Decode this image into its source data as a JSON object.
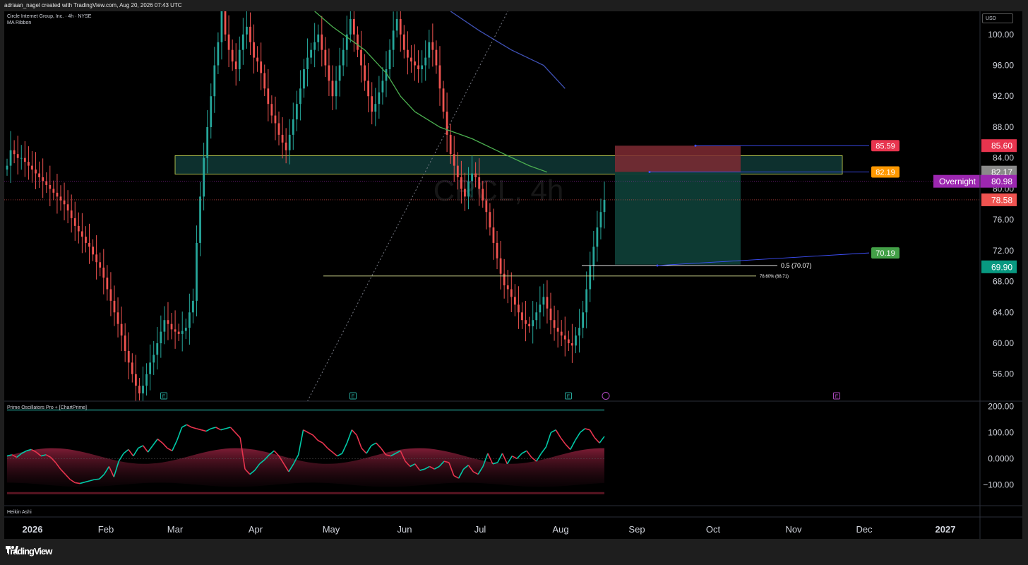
{
  "header": {
    "credit": "adriaan_nagel created with TradingView.com, Aug 20, 2026 07:43 UTC"
  },
  "legend": {
    "symbol_line": "Circle Internet Group, Inc. · 4h · NYSE",
    "indicator": "MA Ribbon",
    "watermark": "CRCL, 4h",
    "oscillator": "Prime Oscillators Pro + [ChartPrime]",
    "chart_style": "Heikin Ashi"
  },
  "currency": "USD",
  "footer": {
    "brand": "TradingView",
    "logo": "tradingview-logo-icon"
  },
  "colors": {
    "up": "#26a69a",
    "down": "#ef5350",
    "ma_fast": "#4caf50",
    "ma_slow": "#3f51b5",
    "zone": "#1d6b66",
    "stop": "#7f2a33",
    "target": "#0e3d36",
    "ob_green": "#00c9a7",
    "ob_red": "#e8344e",
    "bg": "#000000"
  },
  "chart_data": {
    "type": "candlestick",
    "title": "Circle Internet Group, Inc. · 4h · NYSE",
    "symbol": "CRCL",
    "interval": "4h",
    "x_axis_labels": [
      "2026",
      "Feb",
      "Mar",
      "Apr",
      "May",
      "Jun",
      "Jul",
      "Aug",
      "Sep",
      "Oct",
      "Nov",
      "Dec",
      "2027"
    ],
    "y_axis_ticks": [
      100,
      96,
      92,
      88,
      84,
      80,
      76,
      72,
      68,
      64,
      60,
      56
    ],
    "y_axis_tick_labels": [
      "100.00",
      "96.00",
      "92.00",
      "88.00",
      "84.00",
      "80.00",
      "76.00",
      "72.00",
      "68.00",
      "64.00",
      "60.00",
      "56.00"
    ],
    "ylim": [
      52.5,
      103
    ],
    "price_labels": [
      {
        "text": "85.60",
        "value": 85.6,
        "color": "#e8344e"
      },
      {
        "text": "82.17",
        "value": 82.17,
        "color": "#8a8a8a"
      },
      {
        "text": "80.98",
        "value": 80.98,
        "color": "#9c27b0",
        "tag": "Overnight"
      },
      {
        "text": "78.58",
        "value": 78.58,
        "color": "#ef5350"
      },
      {
        "text": "69.90",
        "value": 69.9,
        "color": "#089981"
      }
    ],
    "position_levels": [
      {
        "text": "85.59",
        "value": 85.59,
        "color": "#e8344e"
      },
      {
        "text": "82.19",
        "value": 82.19,
        "color": "#ff9800"
      },
      {
        "text": "70.19",
        "value": 70.19,
        "color": "#43a047"
      }
    ],
    "fib_levels": [
      {
        "text": "0.5 (70.07)",
        "value": 70.07
      },
      {
        "text": "78.60% (68.71)",
        "value": 68.71
      }
    ],
    "resistance_zone": [
      81.9,
      84.3
    ],
    "candle_closes": [
      83,
      85,
      84.5,
      84,
      84,
      83.5,
      83,
      82.5,
      82,
      81.5,
      81,
      80.5,
      80,
      79.5,
      79,
      78.5,
      78,
      77.2,
      76.2,
      75.2,
      74.5,
      73.8,
      73,
      72.5,
      71.5,
      70.5,
      69.8,
      68.5,
      67,
      65.5,
      64,
      62.5,
      61,
      59,
      57.5,
      56,
      54.5,
      53.5,
      54.5,
      56,
      57.5,
      58.5,
      60,
      61.5,
      63,
      62.5,
      61.8,
      61.5,
      61.2,
      61.6,
      62,
      64,
      65.5,
      73,
      79,
      84,
      88,
      92,
      96,
      99,
      103,
      100,
      98,
      96.5,
      95.5,
      98,
      100,
      101,
      99,
      97,
      96.5,
      95,
      93,
      91,
      89.5,
      88.5,
      87,
      86,
      85,
      87,
      89,
      91,
      93,
      95.5,
      97,
      98,
      99,
      100,
      98,
      96,
      94,
      92,
      94,
      96,
      98,
      100,
      102,
      100,
      98,
      96,
      94,
      92,
      90,
      91,
      92.5,
      94,
      95.5,
      98,
      100.5,
      102,
      100,
      98,
      97,
      96.5,
      96,
      95.5,
      96,
      97,
      99,
      98,
      96,
      93,
      90,
      87,
      84.5,
      83,
      81.5,
      80,
      79,
      81,
      82,
      81.5,
      80,
      78.5,
      77,
      75,
      73,
      71,
      69,
      67.5,
      67,
      66,
      65,
      64,
      63,
      62.5,
      62.2,
      63,
      64,
      65,
      66,
      64.5,
      63,
      62,
      61.5,
      61,
      60.5,
      60,
      59.7,
      61,
      62,
      64,
      67,
      70,
      72.5,
      75,
      77,
      78.58
    ],
    "ma_fast": [
      [
        86,
        103
      ],
      [
        91,
        101
      ],
      [
        100,
        98
      ],
      [
        106,
        95
      ],
      [
        110,
        92
      ],
      [
        114,
        90
      ],
      [
        121,
        88
      ],
      [
        130,
        86.5
      ],
      [
        139,
        84.5
      ],
      [
        146,
        83
      ],
      [
        151,
        82.17
      ]
    ],
    "ma_slow": [
      [
        124,
        103
      ],
      [
        132,
        100.5
      ],
      [
        141,
        98
      ],
      [
        150,
        96
      ],
      [
        156,
        93
      ]
    ],
    "trend_line": [
      [
        84,
        52.5
      ],
      [
        140,
        103
      ]
    ],
    "oscillator": {
      "y_ticks": [
        200,
        100,
        0,
        -100
      ],
      "y_tick_labels": [
        "200.00",
        "100.00",
        "0.0000",
        "−100.00"
      ],
      "ylim": [
        -180,
        220
      ],
      "values": [
        10,
        15,
        5,
        20,
        30,
        35,
        25,
        10,
        15,
        5,
        -15,
        -40,
        -60,
        -80,
        -92,
        -95,
        -90,
        -85,
        -80,
        -78,
        -60,
        -30,
        -70,
        -10,
        20,
        35,
        10,
        40,
        50,
        25,
        50,
        75,
        60,
        40,
        30,
        70,
        120,
        130,
        120,
        115,
        110,
        105,
        115,
        120,
        110,
        115,
        120,
        100,
        80,
        -40,
        -60,
        -45,
        -20,
        -5,
        15,
        30,
        10,
        -20,
        -50,
        -20,
        15,
        110,
        100,
        90,
        70,
        60,
        40,
        25,
        10,
        20,
        60,
        110,
        90,
        40,
        20,
        50,
        60,
        40,
        15,
        10,
        20,
        30,
        -10,
        -30,
        -20,
        -45,
        -40,
        -30,
        -40,
        -30,
        -10,
        -15,
        -65,
        -75,
        -40,
        -25,
        -50,
        -60,
        -30,
        20,
        -20,
        -15,
        20,
        -20,
        10,
        0,
        20,
        30,
        5,
        -10,
        20,
        45,
        100,
        110,
        80,
        55,
        35,
        70,
        100,
        115,
        110,
        80,
        60,
        85
      ]
    }
  }
}
